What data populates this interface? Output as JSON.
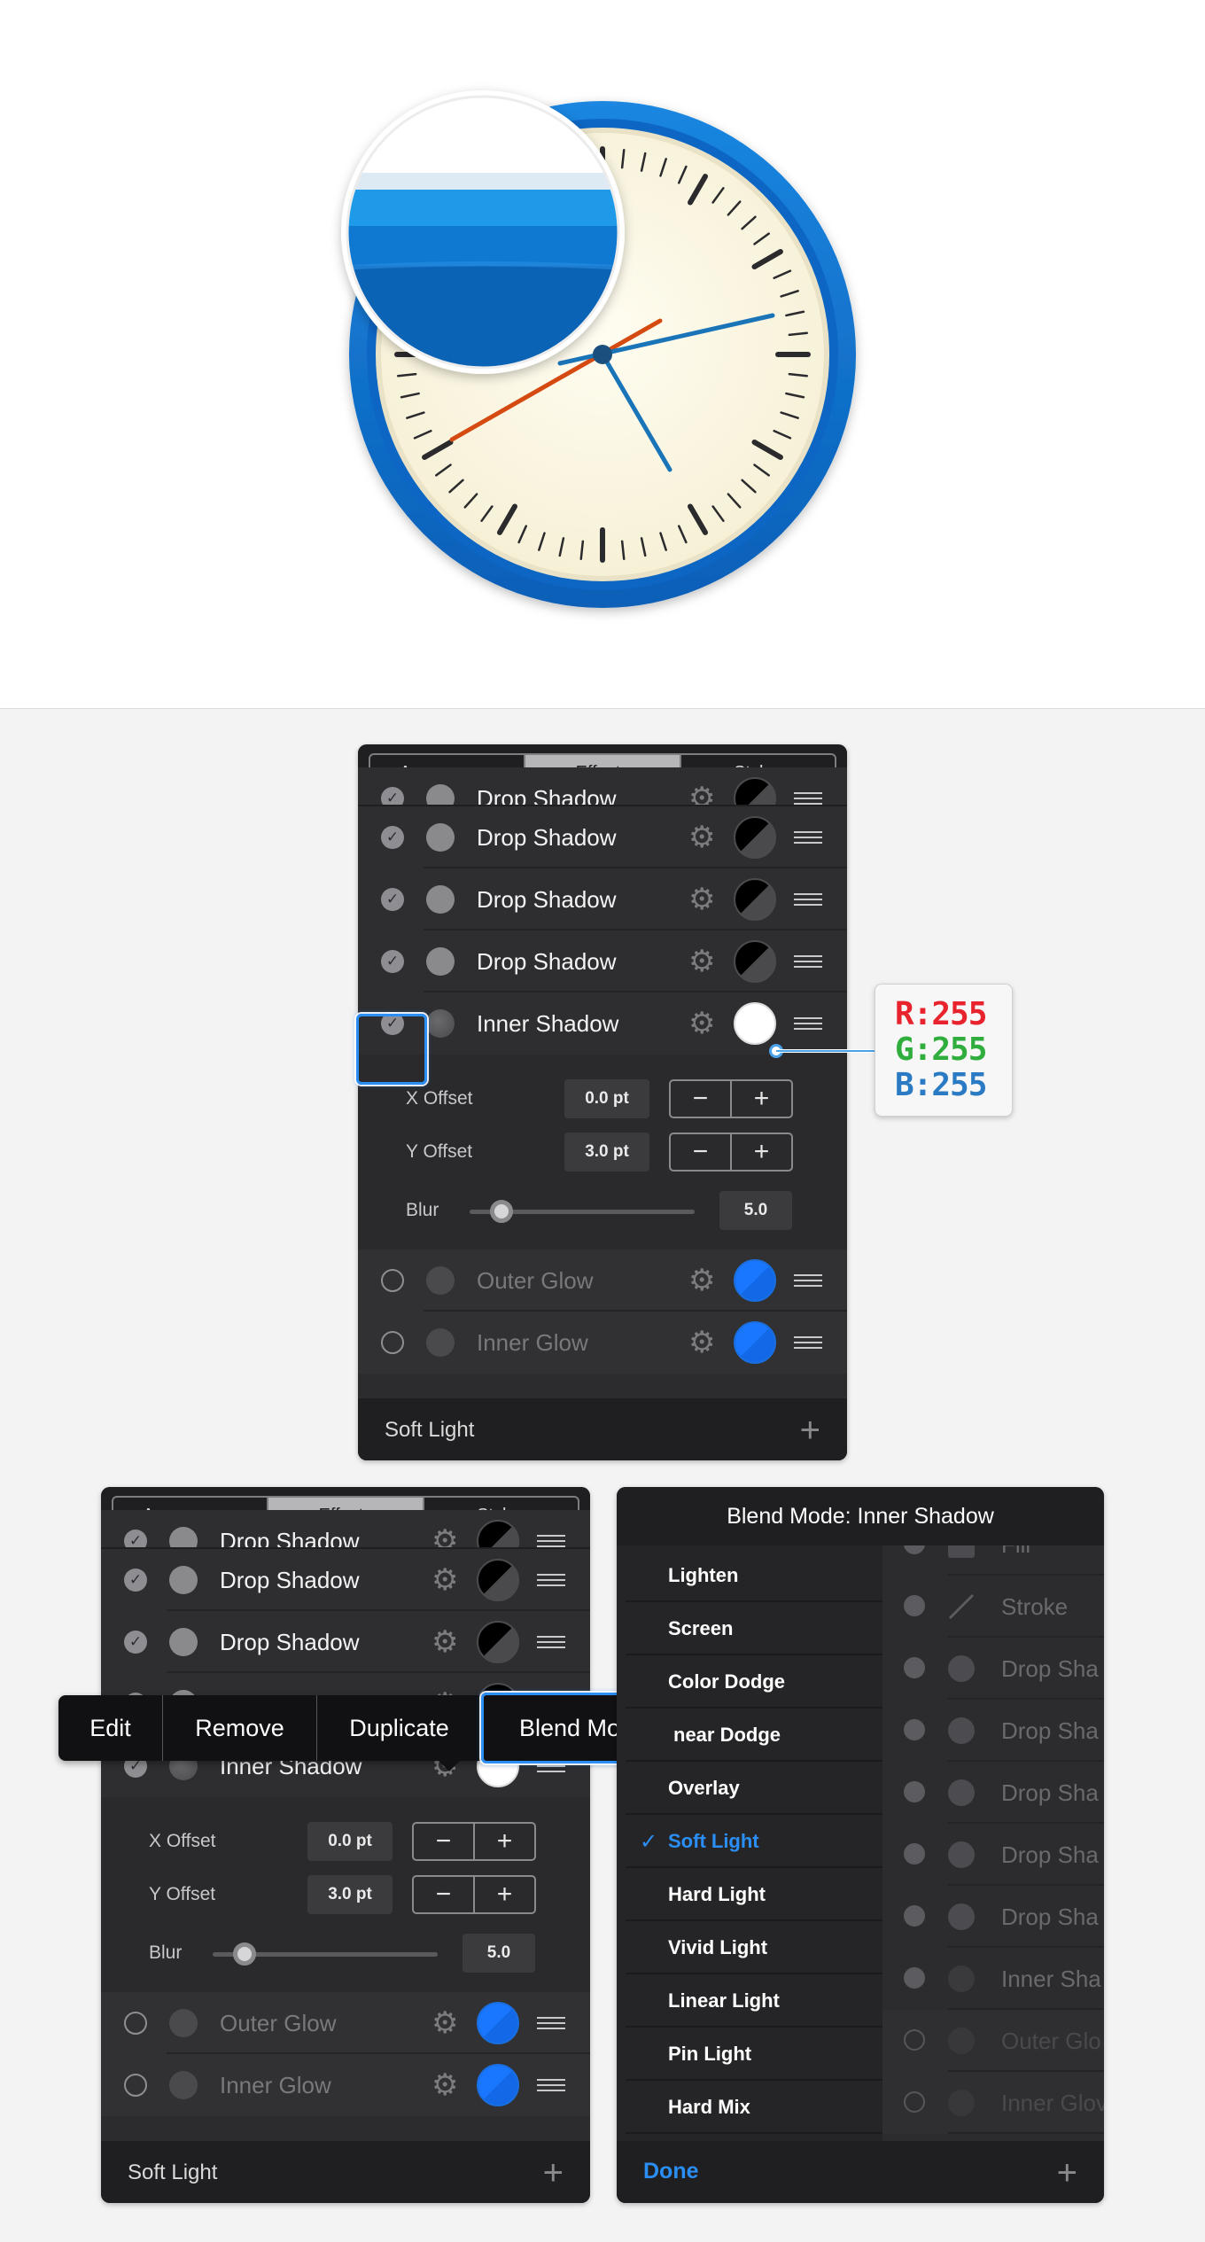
{
  "tabs": [
    "Appearance",
    "Effects",
    "Styles"
  ],
  "active_tab": "Effects",
  "effects_panel": {
    "rows": [
      {
        "label": "Drop Shadow",
        "checked": true,
        "swatch": "half"
      },
      {
        "label": "Drop Shadow",
        "checked": true,
        "swatch": "half"
      },
      {
        "label": "Drop Shadow",
        "checked": true,
        "swatch": "half"
      },
      {
        "label": "Drop Shadow",
        "checked": true,
        "swatch": "half"
      },
      {
        "label": "Inner Shadow",
        "checked": true,
        "swatch": "white"
      },
      {
        "label": "Outer Glow",
        "checked": false,
        "swatch": "blue"
      },
      {
        "label": "Inner Glow",
        "checked": false,
        "swatch": "blue"
      }
    ],
    "x_offset_label": "X Offset",
    "x_offset_value": "0.0 pt",
    "y_offset_label": "Y Offset",
    "y_offset_value": "3.0 pt",
    "blur_label": "Blur",
    "blur_value": "5.0",
    "blur_slider_fraction": 0.1,
    "stepper_minus": "−",
    "stepper_plus": "+",
    "footer_label": "Soft Light",
    "footer_add": "+"
  },
  "color_callout": {
    "r": "R:255",
    "g": "G:255",
    "b": "B:255"
  },
  "context_menu": {
    "items": [
      "Edit",
      "Remove",
      "Duplicate",
      "Blend Mode"
    ],
    "highlighted": "Blend Mode"
  },
  "blend_panel": {
    "title": "Blend Mode: Inner Shadow",
    "options": [
      "Lighten",
      "Screen",
      "Color Dodge",
      "Linear Dodge",
      "Overlay",
      "Soft Light",
      "Hard Light",
      "Vivid Light",
      "Linear Light",
      "Pin Light",
      "Hard Mix"
    ],
    "visible_options": [
      "Lighten",
      "Screen",
      "Color Dodge",
      "near Dodge",
      "Overlay",
      "Soft Light",
      "Hard Light",
      "Vivid Light",
      "Linear Light",
      "Pin Light",
      "Hard Mix"
    ],
    "selected": "Soft Light",
    "checkmark": "✓",
    "background_rows": [
      "Fill",
      "Stroke",
      "Drop Sha",
      "Drop Sha",
      "Drop Sha",
      "Drop Sha",
      "Drop Sha",
      "Inner Sha",
      "Outer Glo",
      "Inner Glov"
    ],
    "done_label": "Done",
    "add_label": "+"
  },
  "clock": {
    "ring_color": "#1170d0",
    "face_color": "#fdf8e4",
    "hour_hand_color": "#d44a10",
    "minute_hand_color": "#1a74b8"
  },
  "colors": {
    "accent": "#2a8ef5",
    "panel_bg": "#2c2c2f"
  }
}
